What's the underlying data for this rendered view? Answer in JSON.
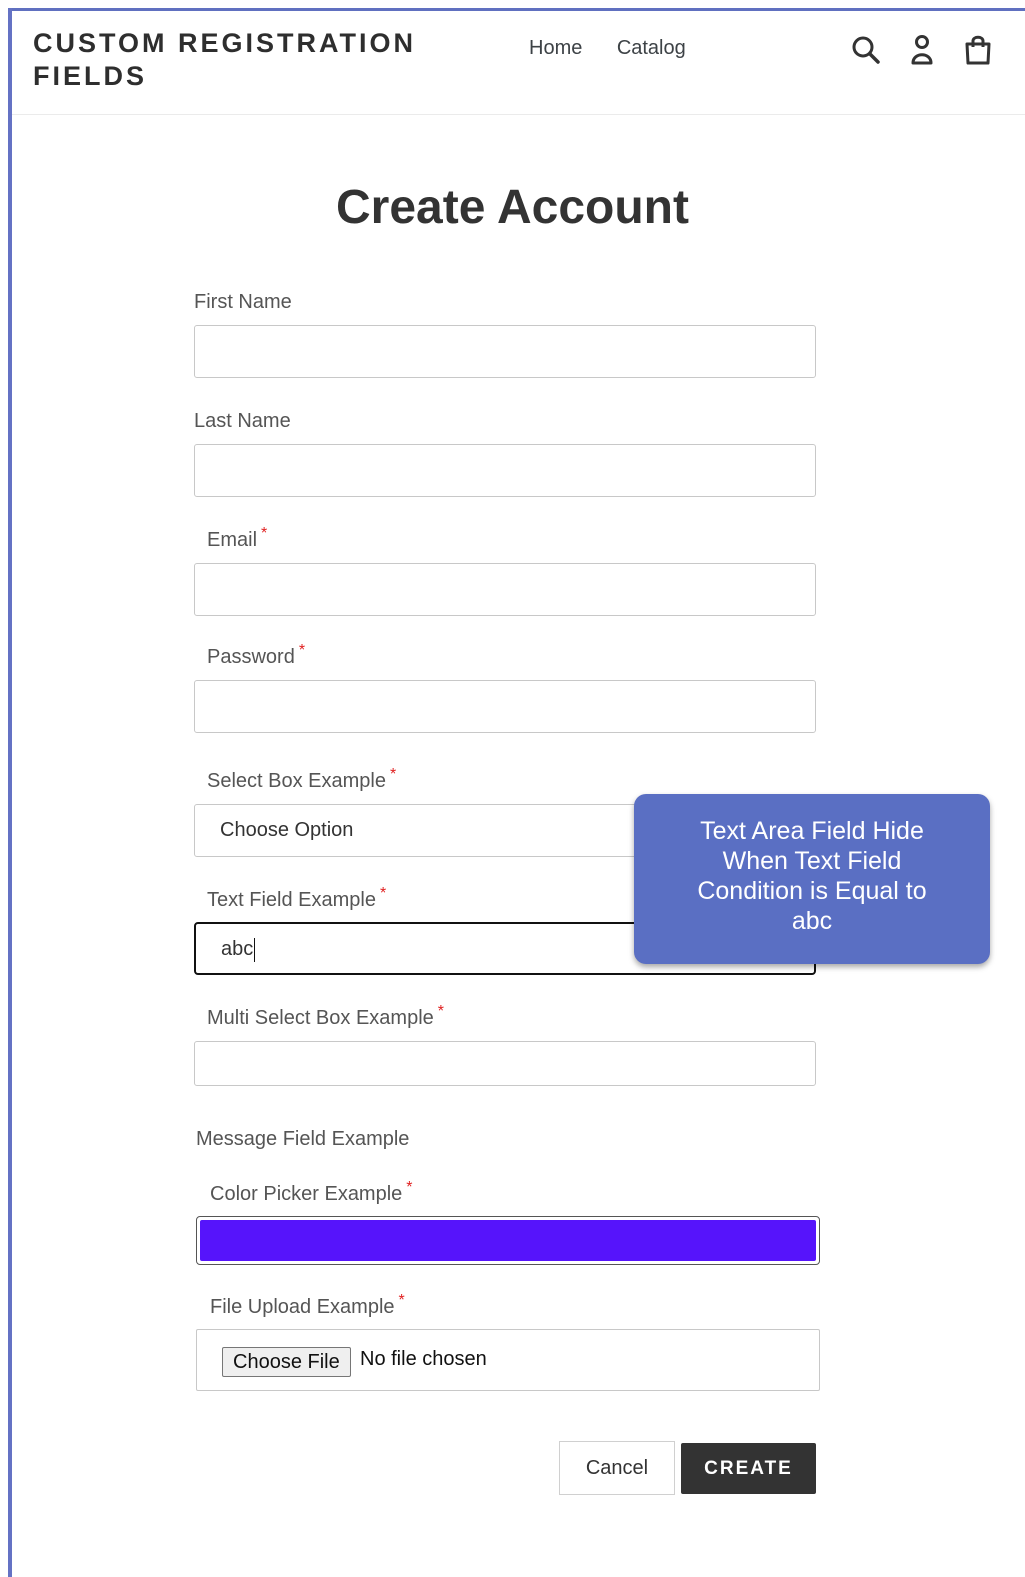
{
  "header": {
    "logo": "CUSTOM REGISTRATION FIELDS",
    "nav": [
      {
        "label": "Home"
      },
      {
        "label": "Catalog"
      }
    ],
    "icons": [
      "search-icon",
      "account-icon",
      "cart-icon"
    ]
  },
  "page_title": "Create Account",
  "fields": {
    "first_name": {
      "label": "First Name",
      "value": ""
    },
    "last_name": {
      "label": "Last Name",
      "value": ""
    },
    "email": {
      "label": "Email",
      "required": "*",
      "value": ""
    },
    "password": {
      "label": "Password",
      "required": "*",
      "value": ""
    },
    "select_box": {
      "label": "Select Box Example",
      "required": "*",
      "value": "Choose Option"
    },
    "text_field": {
      "label": "Text Field Example",
      "required": "*",
      "value": "abc"
    },
    "multi_select": {
      "label": "Multi Select Box Example",
      "required": "*",
      "value": ""
    },
    "message": {
      "label": "Message Field Example"
    },
    "color_picker": {
      "label": "Color Picker Example",
      "required": "*",
      "value": "#5614fb"
    },
    "file_upload": {
      "label": "File Upload Example",
      "required": "*",
      "button": "Choose File",
      "status": "No file chosen"
    }
  },
  "buttons": {
    "cancel": "Cancel",
    "create": "CREATE"
  },
  "tooltip": {
    "text": "Text Area Field Hide When Text Field Condition is Equal to abc"
  },
  "colors": {
    "frame": "#6472c4",
    "tooltip_bg": "#5a6fc3",
    "create_bg": "#333333",
    "required": "#e02020"
  }
}
